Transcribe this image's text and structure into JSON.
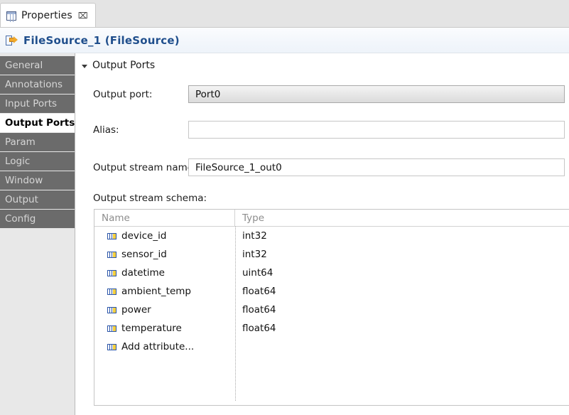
{
  "window": {
    "tab": {
      "label": "Properties",
      "icon": "properties-grid-icon",
      "close_glyph": "⌧"
    }
  },
  "header": {
    "title": "FileSource_1 (FileSource)",
    "icon": "output-port-arrow-icon",
    "title_color": "#1f4e8c"
  },
  "sidebar": {
    "items": [
      {
        "label": "General",
        "selected": false
      },
      {
        "label": "Annotations",
        "selected": false
      },
      {
        "label": "Input Ports",
        "selected": false
      },
      {
        "label": "Output Ports",
        "selected": true
      },
      {
        "label": "Param",
        "selected": false
      },
      {
        "label": "Logic",
        "selected": false
      },
      {
        "label": "Window",
        "selected": false
      },
      {
        "label": "Output",
        "selected": false
      },
      {
        "label": "Config",
        "selected": false
      }
    ]
  },
  "main": {
    "section": {
      "title": "Output Ports",
      "twisty": "chevron-down-icon",
      "expanded": true
    },
    "fields": {
      "output_port": {
        "label": "Output port:",
        "value": "Port0",
        "readonly": true
      },
      "alias": {
        "label": "Alias:",
        "value": "",
        "placeholder": ""
      },
      "output_stream_name": {
        "label": "Output stream name:",
        "value": "FileSource_1_out0"
      }
    },
    "schema": {
      "label": "Output stream schema:",
      "columns": [
        "Name",
        "Type"
      ],
      "rows": [
        {
          "name": "device_id",
          "type": "int32",
          "icon": "attribute-icon"
        },
        {
          "name": "sensor_id",
          "type": "int32",
          "icon": "attribute-icon"
        },
        {
          "name": "datetime",
          "type": "uint64",
          "icon": "attribute-icon"
        },
        {
          "name": "ambient_temp",
          "type": "float64",
          "icon": "attribute-icon"
        },
        {
          "name": "power",
          "type": "float64",
          "icon": "attribute-icon"
        },
        {
          "name": "temperature",
          "type": "float64",
          "icon": "attribute-icon"
        },
        {
          "name": "Add attribute...",
          "type": "",
          "icon": "attribute-icon"
        }
      ]
    }
  }
}
